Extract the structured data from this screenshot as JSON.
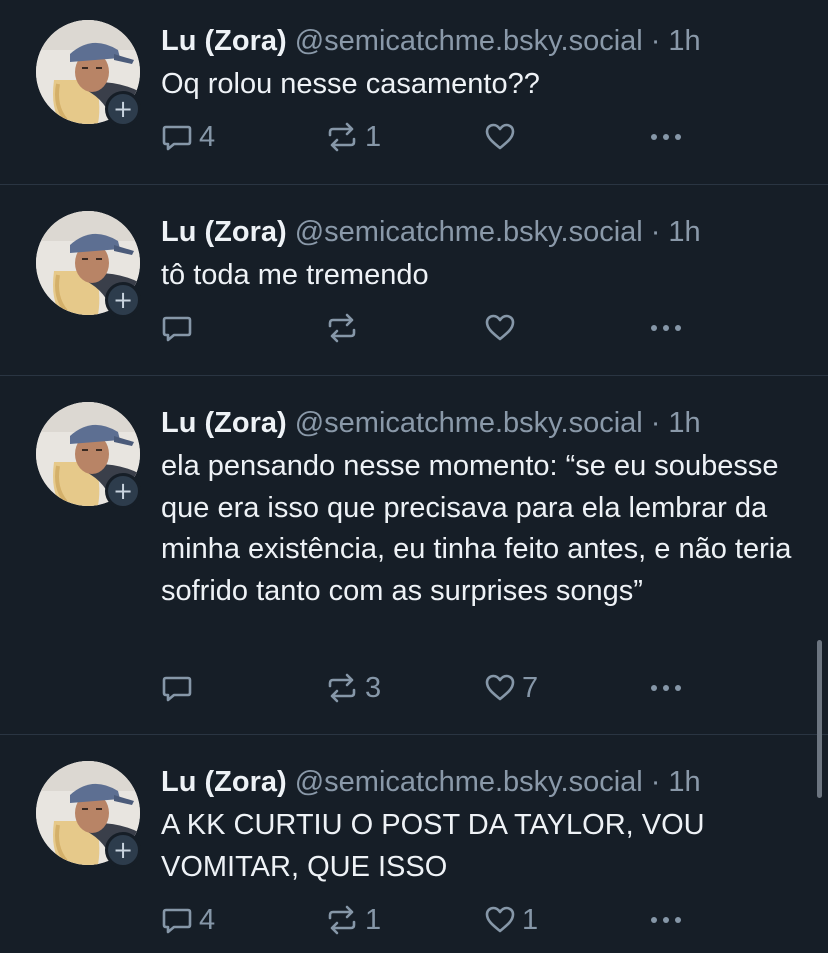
{
  "posts": [
    {
      "author": "Lu (Zora)",
      "handle": "@semicatchme.bsky.social",
      "separator": "·",
      "time": "1h",
      "text": "Oq rolou nesse casamento??",
      "replies": "4",
      "reposts": "1",
      "likes": ""
    },
    {
      "author": "Lu (Zora)",
      "handle": "@semicatchme.bsky.social",
      "separator": "·",
      "time": "1h",
      "text": "tô toda me tremendo",
      "replies": "",
      "reposts": "",
      "likes": ""
    },
    {
      "author": "Lu (Zora)",
      "handle": "@semicatchme.bsky.social",
      "separator": "·",
      "time": "1h",
      "text": "ela pensando nesse momento: “se eu soubesse que era isso que precisava para ela lembrar da minha existência, eu tinha feito antes, e não teria sofrido tanto com as surprises songs”",
      "replies": "",
      "reposts": "3",
      "likes": "7"
    },
    {
      "author": "Lu (Zora)",
      "handle": "@semicatchme.bsky.social",
      "separator": "·",
      "time": "1h",
      "text": "A KK CURTIU O POST DA TAYLOR, VOU VOMITAR, QUE ISSO",
      "replies": "4",
      "reposts": "1",
      "likes": "1"
    }
  ],
  "follow_badge_symbol": "+",
  "colors": {
    "background": "#161e27",
    "text": "#eef2f6",
    "muted": "#8a99a9",
    "divider": "#2a3542",
    "badge": "#2d3c4c"
  },
  "icons": {
    "reply": "reply-icon",
    "repost": "repost-icon",
    "like": "heart-icon",
    "more": "more-options-icon",
    "follow": "plus-icon"
  }
}
